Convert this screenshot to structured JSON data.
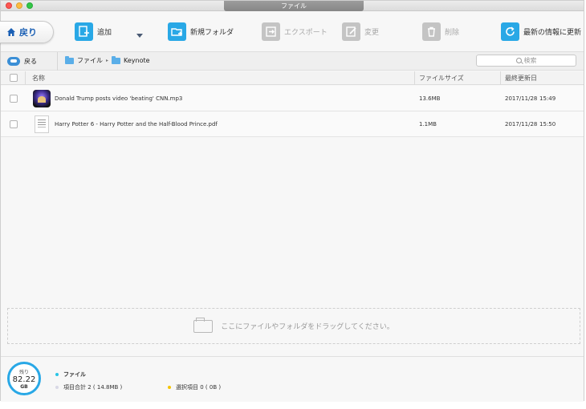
{
  "window": {
    "title": "ファイル"
  },
  "toolbar": {
    "back_label": "戻り",
    "add_label": "追加",
    "new_folder_label": "新規フォルダ",
    "export_label": "エクスポート",
    "change_label": "変更",
    "delete_label": "削除",
    "refresh_label": "最新の情報に更新"
  },
  "nav": {
    "back_label": "戻る",
    "breadcrumb": [
      "ファイル",
      "Keynote"
    ],
    "search_placeholder": "検索"
  },
  "table": {
    "headers": {
      "name": "名称",
      "size": "ファイルサイズ",
      "modified": "最終更新日"
    },
    "rows": [
      {
        "name": "Donald Trump posts video 'beating' CNN.mp3",
        "size": "13.6MB",
        "date": "2017/11/28",
        "time": "15:49",
        "icon": "audio-file-icon"
      },
      {
        "name": "Harry Potter 6 - Harry Potter and the Half-Blood Prince.pdf",
        "size": "1.1MB",
        "date": "2017/11/28",
        "time": "15:50",
        "icon": "pdf-file-icon"
      }
    ]
  },
  "dropzone": {
    "text": "ここにファイルやフォルダをドラッグしてください。"
  },
  "status": {
    "remaining_label": "残り",
    "remaining_value": "82.22",
    "remaining_unit": "GB",
    "files_label": "ファイル",
    "total_label": "項目合計 2 ( 14.8MB )",
    "selected_label": "選択項目 0 ( 0B )"
  },
  "colors": {
    "accent": "#29a8e6",
    "files_dot": "#29c4e6",
    "total_dot": "#d8d8e6",
    "selected_dot": "#f5c400"
  }
}
